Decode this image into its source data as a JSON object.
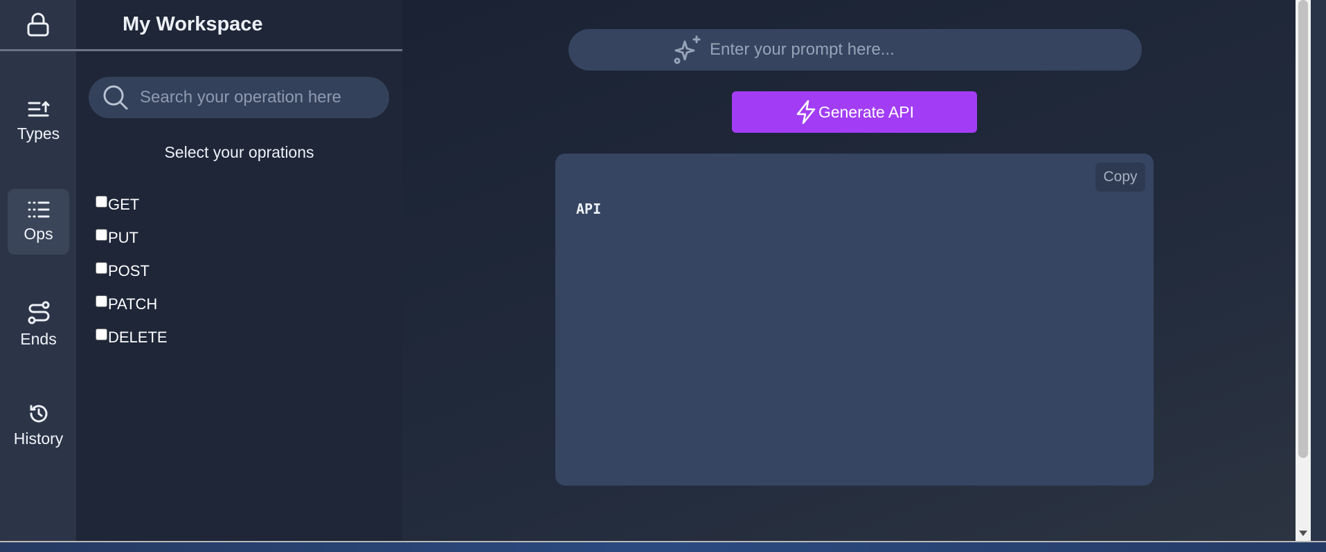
{
  "workspace": {
    "title": "My Workspace"
  },
  "rail": {
    "items": [
      {
        "label": "Types",
        "icon": "list-sort-icon"
      },
      {
        "label": "Ops",
        "icon": "list-bullets-icon",
        "active": true
      },
      {
        "label": "Ends",
        "icon": "route-icon"
      },
      {
        "label": "History",
        "icon": "history-icon"
      }
    ]
  },
  "sidebar": {
    "search_placeholder": "Search your operation here",
    "select_title": "Select your oprations",
    "operations": [
      "GET",
      "PUT",
      "POST",
      "PATCH",
      "DELETE"
    ]
  },
  "main": {
    "prompt_placeholder": "Enter your prompt here...",
    "generate_label": "Generate API",
    "copy_label": "Copy",
    "output_text": "API"
  },
  "colors": {
    "accent": "#a23df5",
    "sidebar_bg": "#1e2638",
    "panel_bg": "#364562"
  }
}
